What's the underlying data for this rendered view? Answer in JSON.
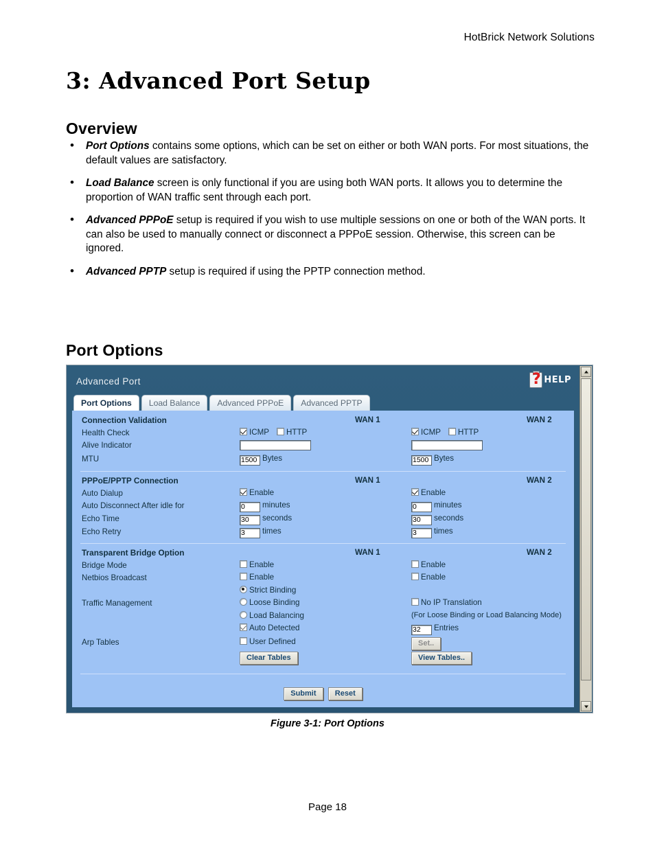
{
  "document": {
    "running_header": "HotBrick Network Solutions",
    "chapter_title": "3: Advanced Port Setup",
    "headings": {
      "overview": "Overview",
      "port_options": "Port Options"
    },
    "bullets": [
      {
        "bold": "Port Options",
        "text": " contains some options, which can be set on either or both WAN ports. For most situations, the default values are satisfactory."
      },
      {
        "bold": "Load Balance",
        "text": " screen is only functional if you are using both WAN ports. It allows you to determine the proportion of WAN traffic sent through each port."
      },
      {
        "bold": "Advanced PPPoE",
        "text": " setup is required if you wish to use multiple sessions on one or both of the WAN ports. It can also be used to manually connect or disconnect a PPPoE session. Otherwise, this screen can be ignored."
      },
      {
        "bold": "Advanced PPTP",
        "text": " setup is required if using the PPTP connection method."
      }
    ],
    "figure_caption": "Figure 3-1: Port Options",
    "page_footer": "Page 18",
    "bullet_glyph": "•"
  },
  "screenshot": {
    "window_title": "Advanced Port",
    "help_label": "HELP",
    "tabs": [
      {
        "label": "Port Options",
        "active": true
      },
      {
        "label": "Load Balance",
        "active": false
      },
      {
        "label": "Advanced PPPoE",
        "active": false
      },
      {
        "label": "Advanced PPTP",
        "active": false
      }
    ],
    "column_headers": {
      "wan1": "WAN 1",
      "wan2": "WAN 2"
    },
    "sections": {
      "connection_validation": {
        "title": "Connection Validation",
        "health_check": {
          "label": "Health Check",
          "icmp_label": "ICMP",
          "http_label": "HTTP",
          "wan1": {
            "icmp": true,
            "http": false
          },
          "wan2": {
            "icmp": true,
            "http": false
          }
        },
        "alive_indicator": {
          "label": "Alive Indicator",
          "wan1_value": "",
          "wan2_value": ""
        },
        "mtu": {
          "label": "MTU",
          "unit": "Bytes",
          "wan1_value": "1500",
          "wan2_value": "1500"
        }
      },
      "pppoe_pptp_connection": {
        "title": "PPPoE/PPTP Connection",
        "auto_dialup": {
          "label": "Auto Dialup",
          "enable_label": "Enable",
          "wan1": true,
          "wan2": true
        },
        "auto_disconnect": {
          "label": "Auto Disconnect After idle for",
          "unit": "minutes",
          "wan1_value": "0",
          "wan2_value": "0"
        },
        "echo_time": {
          "label": "Echo Time",
          "unit": "seconds",
          "wan1_value": "30",
          "wan2_value": "30"
        },
        "echo_retry": {
          "label": "Echo Retry",
          "unit": "times",
          "wan1_value": "3",
          "wan2_value": "3"
        }
      },
      "transparent_bridge_option": {
        "title": "Transparent Bridge Option",
        "bridge_mode": {
          "label": "Bridge Mode",
          "enable_label": "Enable",
          "wan1": false,
          "wan2": false
        },
        "netbios_broadcast": {
          "label": "Netbios Broadcast",
          "enable_label": "Enable",
          "wan1": false,
          "wan2": false
        },
        "traffic_management": {
          "label": "Traffic Management",
          "options": [
            {
              "label": "Strict Binding",
              "selected": true
            },
            {
              "label": "Loose Binding",
              "selected": false
            },
            {
              "label": "Load Balancing",
              "selected": false
            }
          ],
          "no_ip_translation": {
            "label": "No IP Translation",
            "checked": false,
            "hint": "(For Loose Binding or Load Balancing Mode)"
          }
        },
        "arp_tables": {
          "label": "Arp Tables",
          "auto_detected": {
            "label": "Auto Detected",
            "checked": true
          },
          "user_defined": {
            "label": "User Defined",
            "checked": false
          },
          "entries_value": "32",
          "entries_unit": "Entries",
          "set_button": "Set..",
          "clear_tables_button": "Clear Tables",
          "view_tables_button": "View Tables.."
        }
      }
    },
    "actions": {
      "submit": "Submit",
      "reset": "Reset"
    },
    "colors": {
      "window_chrome": "#2b5573",
      "form_background": "#9ec3f5",
      "help_accent": "#e01b1b",
      "button_text": "#1b4a73"
    }
  }
}
